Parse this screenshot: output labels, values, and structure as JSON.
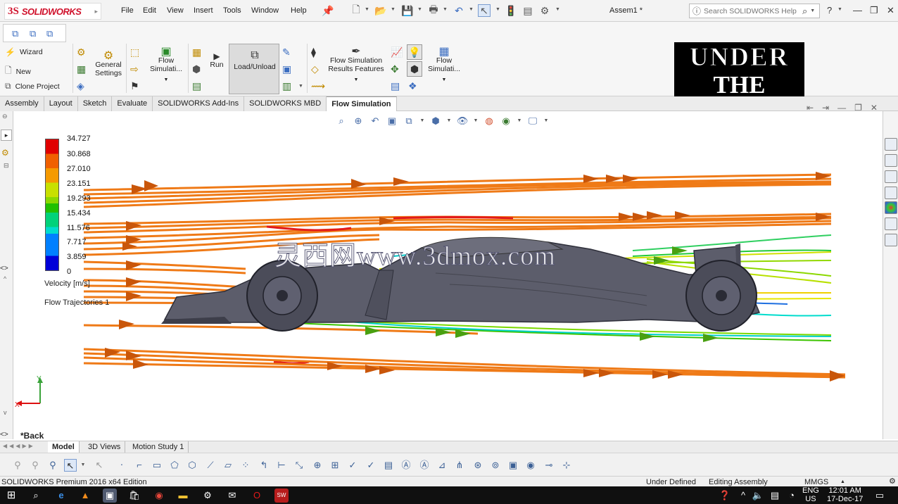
{
  "app": {
    "brand_prefix": "3S",
    "brand_name": "SOLIDWORKS",
    "document_title": "Assem1 *",
    "search_placeholder": "Search SOLIDWORKS Help"
  },
  "menu": [
    "File",
    "Edit",
    "View",
    "Insert",
    "Tools",
    "Window",
    "Help"
  ],
  "commands": {
    "wizard": "Wizard",
    "new": "New",
    "clone_project": "Clone Project",
    "general_settings_1": "General",
    "general_settings_2": "Settings",
    "flow_sim_1": "Flow",
    "flow_sim_2": "Simulati...",
    "run": "Run",
    "load_unload": "Load/Unload",
    "results_features_1": "Flow Simulation",
    "results_features_2": "Results Features",
    "flow_sim_b_1": "Flow",
    "flow_sim_b_2": "Simulati..."
  },
  "logo_overlay": {
    "line1": "UNDER",
    "line2": "THE HOOD"
  },
  "tabs": [
    "Assembly",
    "Layout",
    "Sketch",
    "Evaluate",
    "SOLIDWORKS Add-Ins",
    "SOLIDWORKS MBD",
    "Flow Simulation"
  ],
  "active_tab": "Flow Simulation",
  "legend": {
    "values": [
      "34.727",
      "30.868",
      "27.010",
      "23.151",
      "19.293",
      "15.434",
      "11.576",
      "7.717",
      "3.859",
      "0"
    ],
    "title": "Velocity [m/s]",
    "trajectories": "Flow Trajectories 1",
    "colors": [
      "#e00000",
      "#f06000",
      "#f59a00",
      "#c8e000",
      "#8ad800",
      "#20c000",
      "#00d27a",
      "#00dccd",
      "#0080ff",
      "#0000d8"
    ]
  },
  "watermark": "灵西网www.3dmox.com",
  "view_label": "*Back",
  "axes": {
    "x": "X",
    "y": "Y"
  },
  "model_tabs": [
    "Model",
    "3D Views",
    "Motion Study 1"
  ],
  "status": {
    "edition": "SOLIDWORKS Premium 2016 x64 Edition",
    "under_defined": "Under Defined",
    "editing": "Editing Assembly",
    "units": "MMGS"
  },
  "taskbar": {
    "lang_1": "ENG",
    "lang_2": "US",
    "time": "12:01 AM",
    "date": "17-Dec-17"
  }
}
